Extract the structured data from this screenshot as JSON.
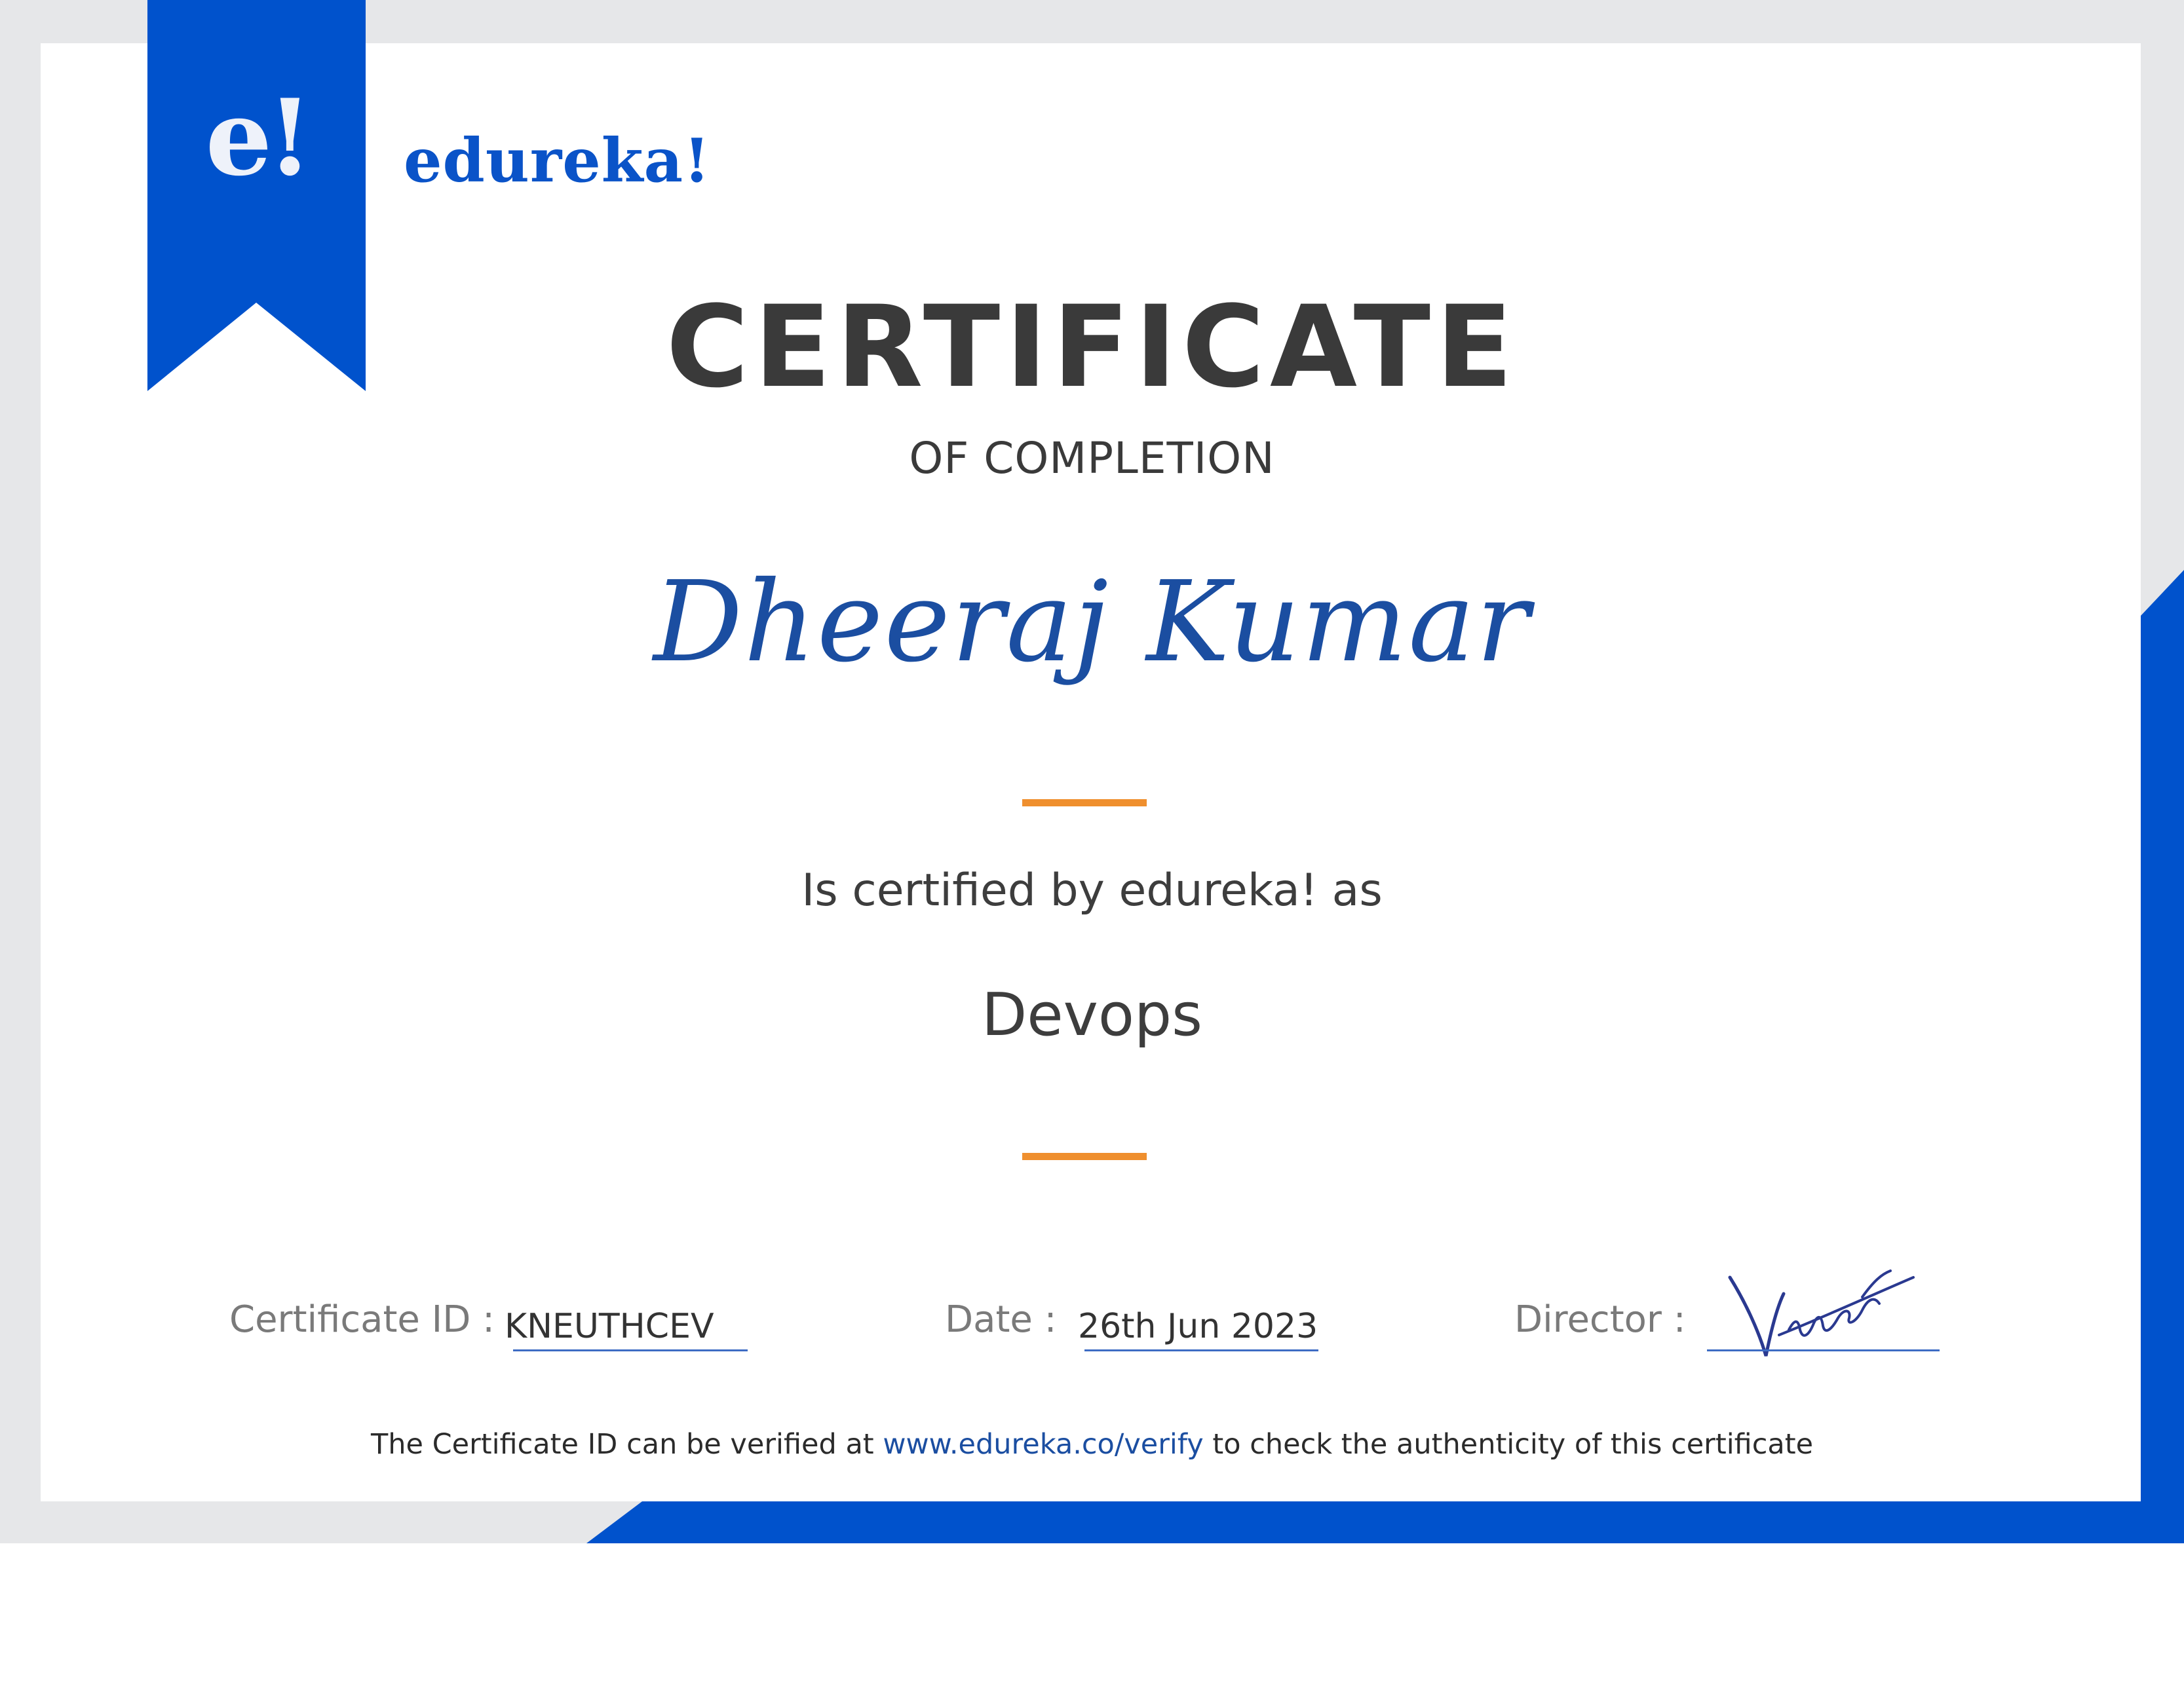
{
  "brand": {
    "badge_text": "e!",
    "wordmark": "edureka!",
    "color": "#0052cc"
  },
  "certificate": {
    "title": "CERTIFICATE",
    "subtitle": "OF COMPLETION",
    "recipient_name": "Dheeraj Kumar",
    "certified_by_text": "Is certified by edureka! as",
    "course_name": "Devops"
  },
  "fields": {
    "certificate_id_label": "Certificate ID :",
    "certificate_id_value": "KNEUTHCEV",
    "date_label": "Date :",
    "date_value": "26th Jun 2023",
    "director_label": "Director :",
    "director_signature": "Vineet"
  },
  "verification": {
    "prefix": "The Certificate ID can be verified at",
    "link_text": "www.edureka.co/verify",
    "suffix": "to check the authenticity of this certificate"
  },
  "colors": {
    "frame_grey": "#e6e7e9",
    "accent_orange": "#ef8f2e",
    "title_text": "#3a3a3a",
    "name_blue": "#1b4ea1"
  },
  "icons": {
    "badge": "edureka-ribbon-badge-icon",
    "signature": "director-signature-icon"
  }
}
